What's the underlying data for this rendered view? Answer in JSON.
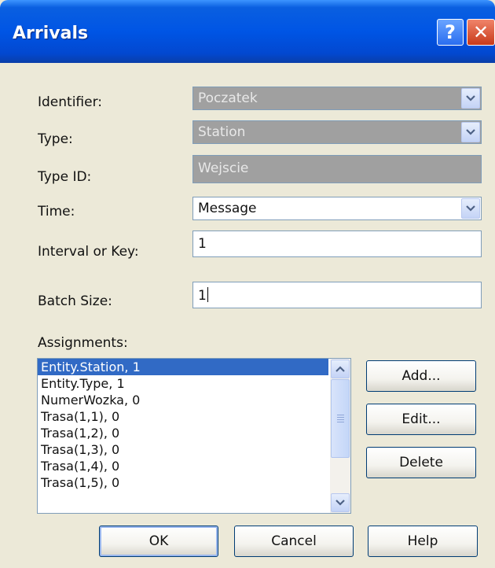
{
  "window": {
    "title": "Arrivals",
    "help_glyph": "?",
    "close_glyph": "✕"
  },
  "form": {
    "identifier": {
      "label": "Identifier:",
      "value": "Poczatek"
    },
    "type": {
      "label": "Type:",
      "value": "Station"
    },
    "type_id": {
      "label": "Type ID:",
      "value": "Wejscie"
    },
    "time": {
      "label": "Time:",
      "value": "Message"
    },
    "interval": {
      "label": "Interval or Key:",
      "value": "1"
    },
    "batch": {
      "label": "Batch Size:",
      "value": "1"
    },
    "assignments_label": "Assignments:"
  },
  "assignments": {
    "items": [
      "Entity.Station, 1",
      "Entity.Type, 1",
      "NumerWozka, 0",
      "Trasa(1,1), 0",
      "Trasa(1,2), 0",
      "Trasa(1,3), 0",
      "Trasa(1,4), 0",
      "Trasa(1,5), 0"
    ],
    "selected": "Entity.Station, 1"
  },
  "side_buttons": {
    "add": "Add...",
    "edit": "Edit...",
    "delete": "Delete"
  },
  "footer": {
    "ok": "OK",
    "cancel": "Cancel",
    "help": "Help"
  },
  "colors": {
    "title_bar": "#0055e5",
    "disabled_field": "#a0a0a0",
    "selection": "#316ac5",
    "dialog_bg": "#ece9d8"
  },
  "icons": {
    "help": "question-icon",
    "close": "close-icon",
    "dropdown": "chevron-down-icon"
  }
}
